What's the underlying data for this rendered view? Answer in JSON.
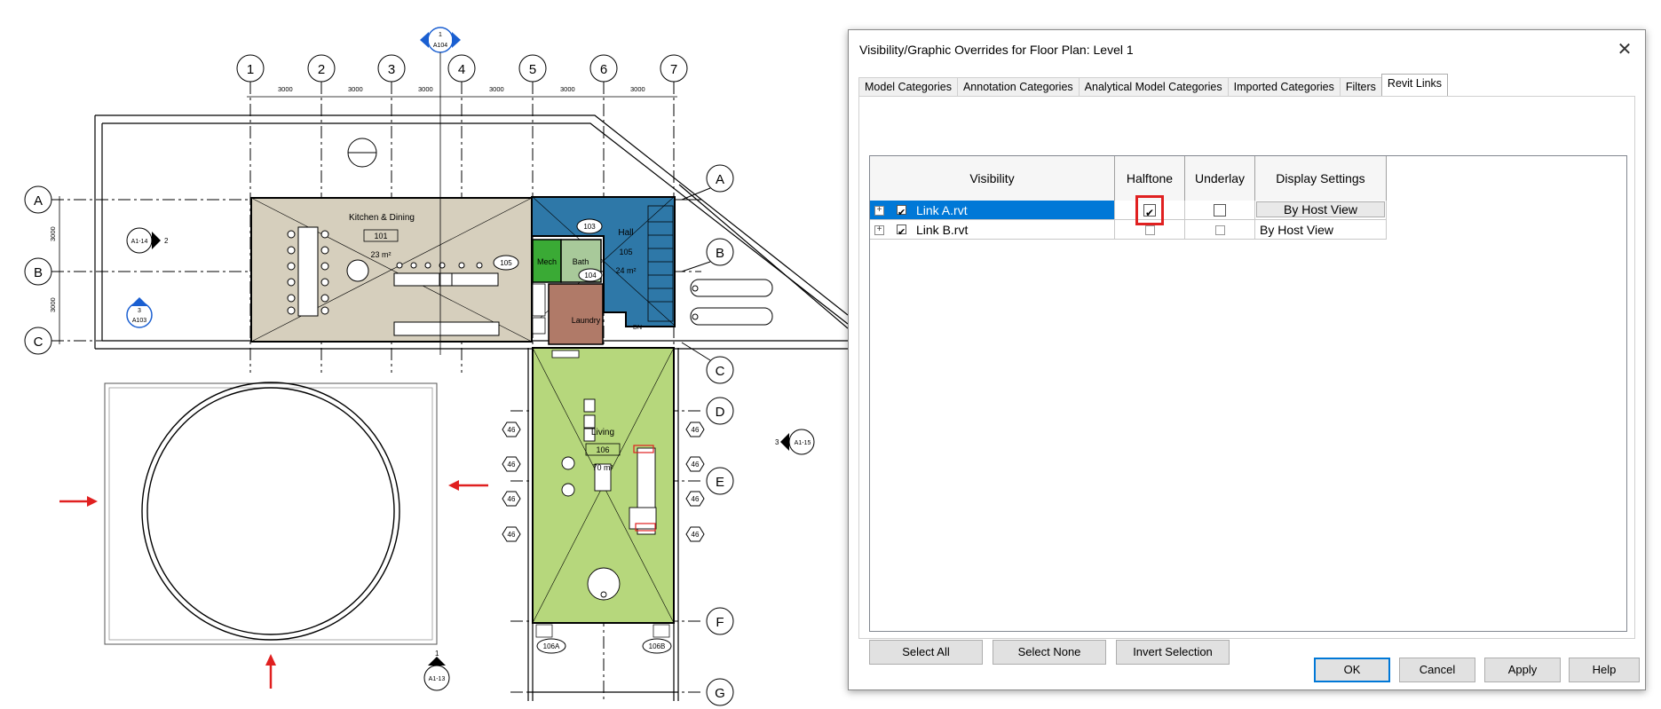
{
  "plan": {
    "grid_numbers": [
      "1",
      "2",
      "3",
      "4",
      "5",
      "6",
      "7"
    ],
    "grid_letters_left": [
      "A",
      "B",
      "C"
    ],
    "grid_letters_right": [
      "A",
      "B",
      "C",
      "D",
      "E",
      "F",
      "G"
    ],
    "dims": [
      "3000",
      "3000",
      "3000",
      "3000",
      "3000",
      "3000"
    ],
    "dims_vertical": [
      "3000",
      "3000"
    ],
    "rooms": [
      {
        "name": "Kitchen & Dining",
        "number": "101",
        "area": "23 m²"
      },
      {
        "name": "Hall",
        "number": "103",
        "area": "24 m²",
        "tag": "105"
      },
      {
        "name": "Mech",
        "number": "105"
      },
      {
        "name": "Bath",
        "number": "104"
      },
      {
        "name": "Laundry"
      },
      {
        "name": "Living",
        "number": "106",
        "area": "70 m²"
      }
    ],
    "section_marks": [
      "A1-14",
      "A103",
      "A104",
      "A1-15",
      "A1-13"
    ],
    "section_numbers": [
      "1",
      "2",
      "3",
      "3",
      "1"
    ],
    "window_tags": [
      "46",
      "46",
      "46",
      "46",
      "46",
      "46",
      "46",
      "46"
    ],
    "door_tags": [
      "106A",
      "106B"
    ],
    "stair_label": "DN"
  },
  "dialog": {
    "title": "Visibility/Graphic Overrides for Floor Plan: Level 1",
    "tabs": [
      "Model Categories",
      "Annotation Categories",
      "Analytical Model Categories",
      "Imported Categories",
      "Filters",
      "Revit Links"
    ],
    "active_tab": "Revit Links",
    "columns": [
      "Visibility",
      "Halftone",
      "Underlay",
      "Display Settings"
    ],
    "rows": [
      {
        "name": "Link A.rvt",
        "visible": true,
        "halftone": true,
        "underlay": false,
        "display": "By Host View",
        "selected": true
      },
      {
        "name": "Link B.rvt",
        "visible": true,
        "halftone": false,
        "underlay": false,
        "display": "By Host View",
        "selected": false
      }
    ],
    "select_buttons": [
      "Select All",
      "Select None",
      "Invert Selection"
    ],
    "footer_buttons": [
      "OK",
      "Cancel",
      "Apply",
      "Help"
    ],
    "accent": "#0078d7",
    "highlight": "#e02020"
  }
}
